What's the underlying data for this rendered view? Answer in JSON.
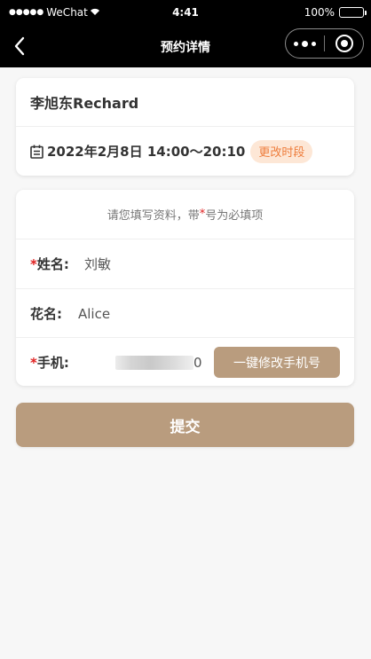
{
  "status_bar": {
    "signal": "●●●●●",
    "carrier": "WeChat",
    "time": "4:41",
    "battery": "100%"
  },
  "nav": {
    "title": "预约详情"
  },
  "booking": {
    "name": "李旭东Rechard",
    "datetime": "2022年2月8日 14:00～20:10",
    "change_time_label": "更改时段"
  },
  "form": {
    "hint_prefix": "请您填写资料，带",
    "hint_star": "*",
    "hint_suffix": "号为必填项",
    "fields": [
      {
        "required_mark": "*",
        "label": "姓名:",
        "value": "刘敏"
      },
      {
        "required_mark": "",
        "label": "花名:",
        "value": "Alice"
      },
      {
        "required_mark": "*",
        "label": "手机:",
        "value_visible_tail": "0"
      }
    ],
    "modify_phone_label": "一键修改手机号"
  },
  "submit_label": "提交",
  "colors": {
    "primary": "#b99c7e",
    "badge_bg": "#fde7d6",
    "badge_text": "#ee7d3c",
    "required": "#e02020"
  }
}
